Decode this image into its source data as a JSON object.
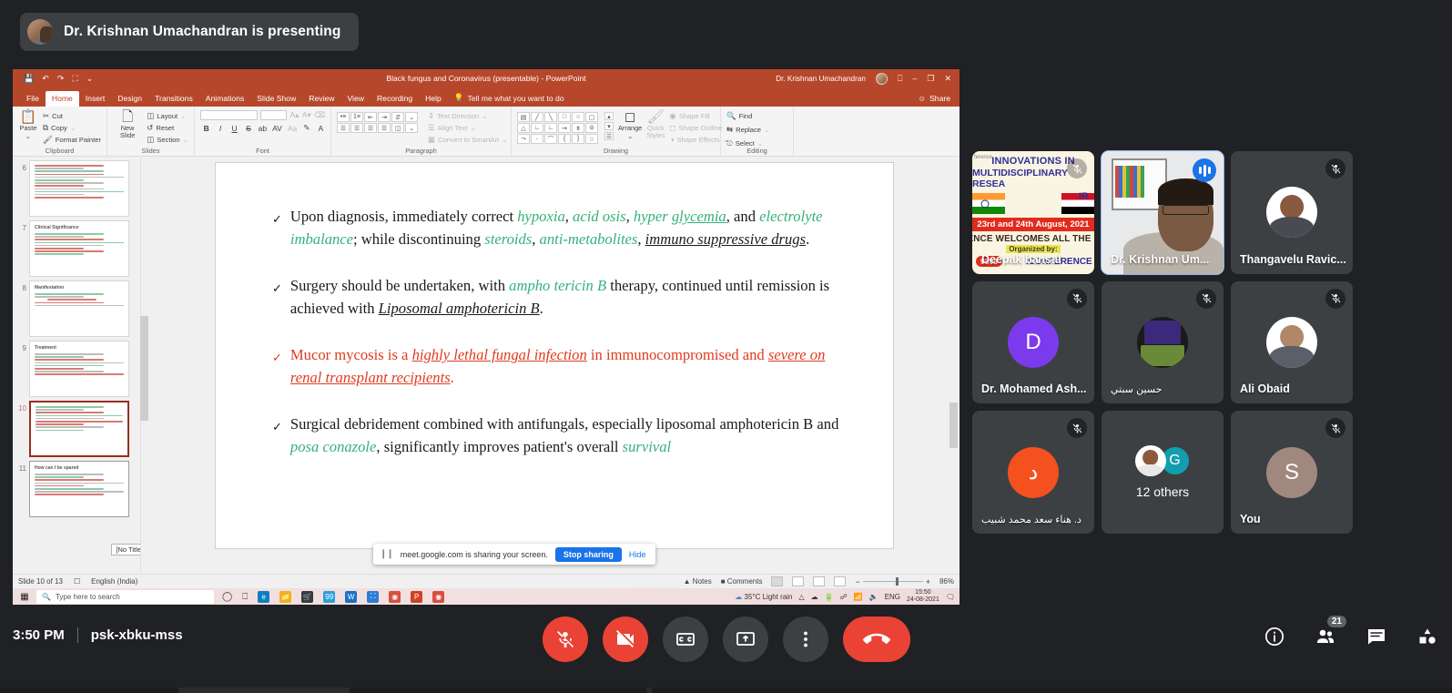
{
  "meet": {
    "presenting_banner": "Dr. Krishnan Umachandran is presenting",
    "time": "3:50 PM",
    "meeting_code": "psk-xbku-mss",
    "participant_count": "21",
    "controls": [
      {
        "name": "microphone-off-button",
        "label": "mic-off-icon"
      },
      {
        "name": "camera-off-button",
        "label": "camera-off-icon"
      },
      {
        "name": "captions-button",
        "label": "cc-icon"
      },
      {
        "name": "present-now-button",
        "label": "present-screen-icon"
      },
      {
        "name": "more-options-button",
        "label": "more-vert-icon"
      },
      {
        "name": "leave-call-button",
        "label": "hang-up-icon"
      }
    ],
    "right_controls": [
      {
        "name": "meeting-details-button",
        "label": "info-icon"
      },
      {
        "name": "show-everyone-button",
        "label": "people-icon"
      },
      {
        "name": "chat-button",
        "label": "chat-icon"
      },
      {
        "name": "activities-button",
        "label": "activities-icon"
      }
    ],
    "participants": [
      {
        "name": "Deepak bansal",
        "type": "poster",
        "muted": true,
        "speaking": false,
        "active": false
      },
      {
        "name": "Dr. Krishnan Um...",
        "type": "video",
        "muted": false,
        "speaking": true,
        "active": true
      },
      {
        "name": "Thangavelu Ravic...",
        "type": "photo",
        "muted": true,
        "speaking": false,
        "active": false
      },
      {
        "name": "Dr. Mohamed Ash...",
        "type": "initial",
        "initial": "D",
        "color": "#7c3aed",
        "muted": true,
        "speaking": false,
        "active": false
      },
      {
        "name": "حسين سبتي",
        "type": "photo",
        "rtl": true,
        "muted": true,
        "speaking": false,
        "active": false
      },
      {
        "name": "Ali Obaid",
        "type": "photo",
        "muted": true,
        "speaking": false,
        "active": false
      },
      {
        "name": "د. هناء سعد محمد شبيب",
        "type": "initial",
        "initial": "د",
        "color": "#f4511e",
        "rtl": true,
        "muted": true,
        "speaking": false,
        "active": false
      },
      {
        "name": "12 others",
        "type": "others",
        "group_initial": "G",
        "muted": false,
        "speaking": false,
        "active": false
      },
      {
        "name": "You",
        "type": "initial",
        "initial": "S",
        "color": "#a1887f",
        "muted": true,
        "speaking": false,
        "active": false
      }
    ]
  },
  "share_bubble": {
    "message": "meet.google.com is sharing your screen.",
    "stop_label": "Stop sharing",
    "hide_label": "Hide"
  },
  "powerpoint": {
    "document_title": "Black fungus and Coronavirus (presentable)  -  PowerPoint",
    "account_name": "Dr. Krishnan Umachandran",
    "share_label": "Share",
    "tell_me_placeholder": "Tell me what you want to do",
    "tabs": [
      "File",
      "Home",
      "Insert",
      "Design",
      "Transitions",
      "Animations",
      "Slide Show",
      "Review",
      "View",
      "Recording",
      "Help"
    ],
    "active_tab": "Home",
    "ribbon": {
      "clipboard": {
        "label": "Clipboard",
        "paste": "Paste",
        "items": [
          "Cut",
          "Copy",
          "Format Painter"
        ]
      },
      "slides": {
        "label": "Slides",
        "new_slide": "New Slide",
        "items": [
          "Layout",
          "Reset",
          "Section"
        ]
      },
      "font": {
        "label": "Font"
      },
      "paragraph": {
        "label": "Paragraph",
        "items": [
          "Text Direction",
          "Align Text",
          "Convert to SmartArt"
        ]
      },
      "drawing": {
        "label": "Drawing",
        "arrange": "Arrange",
        "quick_styles": "Quick Styles",
        "items": [
          "Shape Fill",
          "Shape Outline",
          "Shape Effects"
        ]
      },
      "editing": {
        "label": "Editing",
        "items": [
          "Find",
          "Replace",
          "Select"
        ]
      }
    },
    "status_bar": {
      "slide_indicator": "Slide 10 of 13",
      "language": "English (India)",
      "notes": "Notes",
      "comments": "Comments",
      "zoom": "86%"
    },
    "thumbnails": [
      {
        "number": "6",
        "title": "",
        "selected": false
      },
      {
        "number": "7",
        "title": "Clinical Significance",
        "selected": false
      },
      {
        "number": "8",
        "title": "Manifestation",
        "selected": false
      },
      {
        "number": "9",
        "title": "Treatment",
        "selected": false
      },
      {
        "number": "10",
        "title": "",
        "selected": true
      },
      {
        "number": "11",
        "title": "How can I be spared",
        "selected": false
      }
    ],
    "thumb_tooltip": "[No Title]",
    "slide": {
      "bullets": [
        {
          "color": "dark",
          "segments": [
            {
              "t": "Upon diagnosis, immediately correct ",
              "s": "plain"
            },
            {
              "t": "hypoxia",
              "s": "green-italic"
            },
            {
              "t": ", ",
              "s": "plain"
            },
            {
              "t": "acid osis",
              "s": "green-italic"
            },
            {
              "t": ", ",
              "s": "plain"
            },
            {
              "t": "hyper ",
              "s": "green-italic"
            },
            {
              "t": "glycemia",
              "s": "green-italic-underline"
            },
            {
              "t": ", and ",
              "s": "plain"
            },
            {
              "t": "electrolyte imbalance",
              "s": "green-italic"
            },
            {
              "t": "; while discontinuing ",
              "s": "plain"
            },
            {
              "t": "steroids",
              "s": "green-italic"
            },
            {
              "t": ", ",
              "s": "plain"
            },
            {
              "t": "anti-metabolites",
              "s": "green-italic"
            },
            {
              "t": ", ",
              "s": "plain"
            },
            {
              "t": "immuno suppressive drugs",
              "s": "italic-underline"
            },
            {
              "t": ".",
              "s": "plain"
            }
          ]
        },
        {
          "color": "dark",
          "segments": [
            {
              "t": "Surgery should be undertaken, with ",
              "s": "plain"
            },
            {
              "t": "ampho tericin B",
              "s": "green-italic"
            },
            {
              "t": " therapy, continued until remission is achieved with ",
              "s": "plain"
            },
            {
              "t": "Liposomal amphotericin B",
              "s": "italic-underline"
            },
            {
              "t": ".",
              "s": "plain"
            }
          ]
        },
        {
          "color": "red",
          "segments": [
            {
              "t": "Mucor mycosis is a ",
              "s": "plain"
            },
            {
              "t": "highly lethal fungal infection",
              "s": "italic-underline"
            },
            {
              "t": " in immunocompromised and ",
              "s": "plain"
            },
            {
              "t": "severe on renal transplant recipients",
              "s": "italic-underline"
            },
            {
              "t": ".",
              "s": "plain"
            }
          ]
        },
        {
          "color": "dark",
          "segments": [
            {
              "t": "Surgical debridement combined with antifungals, especially liposomal amphotericin B and ",
              "s": "plain"
            },
            {
              "t": "posa conazole",
              "s": "green-italic"
            },
            {
              "t": ", significantly improves patient's overall ",
              "s": "plain"
            },
            {
              "t": "survival",
              "s": "green-italic"
            }
          ]
        }
      ]
    }
  },
  "taskbar": {
    "search_placeholder": "Type here to search",
    "weather": "35°C  Light rain",
    "language": "ENG",
    "clock_time": "15:50",
    "clock_date": "24-08-2021"
  },
  "colors": {
    "ppt_accent": "#b7472a",
    "meet_bg": "#202124",
    "tile_bg": "#3c4043",
    "active_outline": "#8ab4f8",
    "danger": "#ea4335",
    "link": "#1a73e8"
  }
}
